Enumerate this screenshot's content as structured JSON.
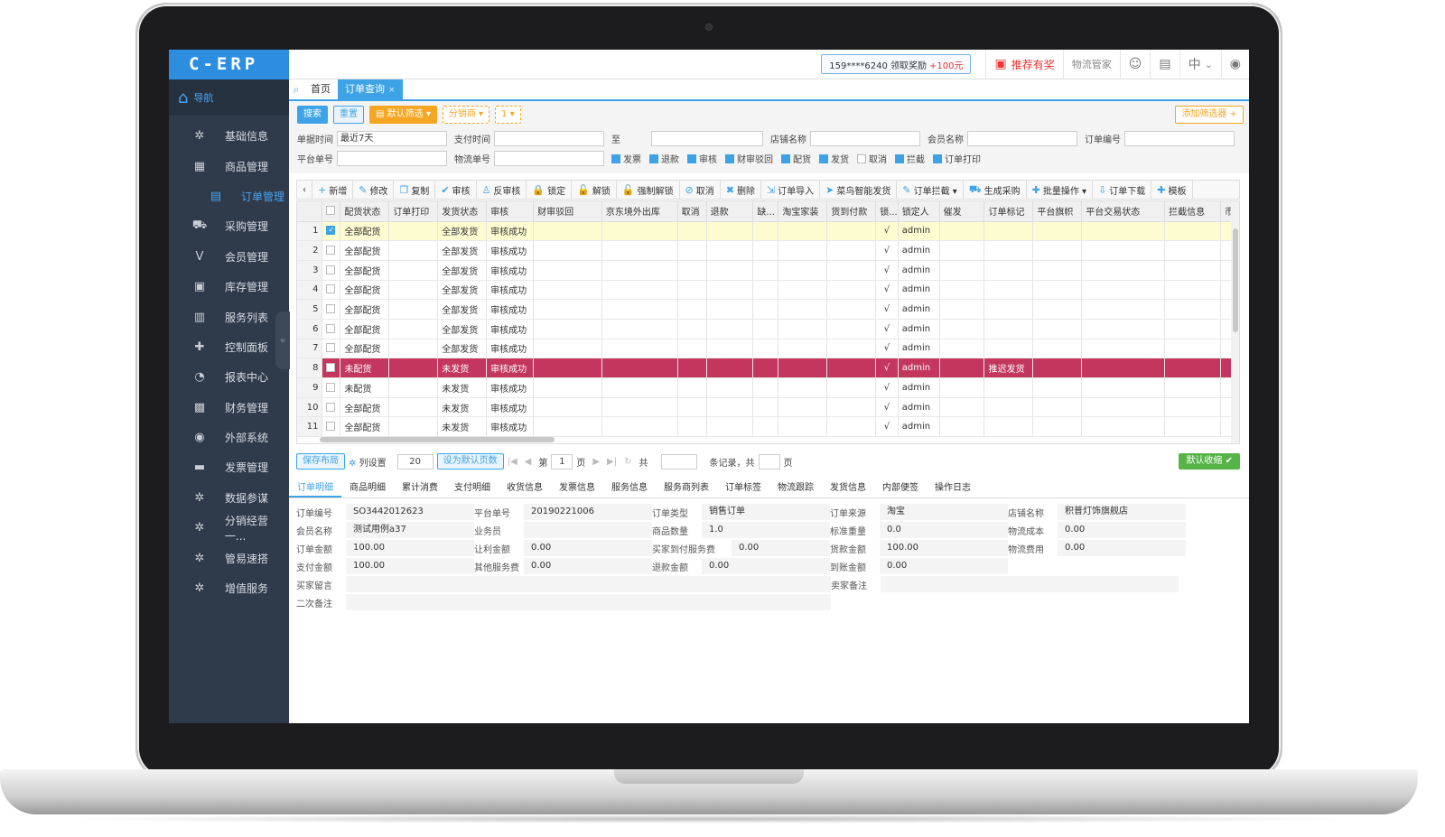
{
  "app": {
    "logo": "C-ERP",
    "nav_label": "导航"
  },
  "sidebar": {
    "items": [
      {
        "label": "基础信息",
        "icon": "gear-icon"
      },
      {
        "label": "商品管理",
        "icon": "store-icon"
      },
      {
        "label": "订单管理",
        "icon": "clipboard-icon",
        "sub": true
      },
      {
        "label": "采购管理",
        "icon": "cart-icon"
      },
      {
        "label": "会员管理",
        "icon": "v-icon"
      },
      {
        "label": "库存管理",
        "icon": "box-icon"
      },
      {
        "label": "服务列表",
        "icon": "book-icon"
      },
      {
        "label": "控制面板",
        "icon": "grid-icon"
      },
      {
        "label": "报表中心",
        "icon": "pie-icon"
      },
      {
        "label": "财务管理",
        "icon": "wallet-icon"
      },
      {
        "label": "外部系统",
        "icon": "compass-icon"
      },
      {
        "label": "发票管理",
        "icon": "invoice-icon"
      },
      {
        "label": "数据参谋",
        "icon": "gear-icon"
      },
      {
        "label": "分销经营一...",
        "icon": "gear-icon"
      },
      {
        "label": "管易速搭",
        "icon": "gear-icon"
      },
      {
        "label": "增值服务",
        "icon": "gear-icon"
      }
    ]
  },
  "topbar": {
    "promo": "159****6240 领取奖励",
    "promo_plus": "+100元",
    "recommend": "推荐有奖",
    "logistics": "物流管家",
    "lang": "中"
  },
  "tabs": {
    "home": "首页",
    "order_query": "订单查询",
    "close": "×"
  },
  "filters": {
    "search": "搜索",
    "reset": "重置",
    "default_filter": "默认筛选",
    "distributor": "分销商",
    "one": "1",
    "add_filter": "添加筛选器 +",
    "doc_time_label": "单据时间",
    "doc_time_value": "最近7天",
    "pay_time_label": "支付时间",
    "to": "至",
    "shop_name_label": "店铺名称",
    "member_name_label": "会员名称",
    "order_no_label": "订单编号",
    "platform_no_label": "平台单号",
    "logistics_no_label": "物流单号",
    "checks": [
      "发票",
      "退款",
      "审核",
      "财审驳回",
      "配货",
      "发货",
      "取消",
      "拦截",
      "订单打印"
    ]
  },
  "toolbar": [
    {
      "label": "新增",
      "icon": "plus-icon"
    },
    {
      "label": "修改",
      "icon": "edit-icon"
    },
    {
      "label": "复制",
      "icon": "copy-icon"
    },
    {
      "label": "审核",
      "icon": "check-icon"
    },
    {
      "label": "反审核",
      "icon": "user-icon"
    },
    {
      "label": "锁定",
      "icon": "lock-icon"
    },
    {
      "label": "解锁",
      "icon": "unlock-icon"
    },
    {
      "label": "强制解锁",
      "icon": "unlock-icon"
    },
    {
      "label": "取消",
      "icon": "cancel-icon"
    },
    {
      "label": "删除",
      "icon": "trash-icon"
    },
    {
      "label": "订单导入",
      "icon": "import-icon"
    },
    {
      "label": "菜鸟智能发货",
      "icon": "ship-icon"
    },
    {
      "label": "订单拦截 ▾",
      "icon": "edit-icon"
    },
    {
      "label": "生成采购",
      "icon": "cart-icon"
    },
    {
      "label": "批量操作 ▾",
      "icon": "grid-icon"
    },
    {
      "label": "订单下载",
      "icon": "download-icon"
    },
    {
      "label": "模板",
      "icon": "grid-icon"
    }
  ],
  "grid": {
    "columns": [
      "",
      "",
      "配货状态",
      "订单打印",
      "发货状态",
      "审核",
      "财审驳回",
      "京东境外出库",
      "取消",
      "退款",
      "缺...",
      "淘宝家装",
      "货到付款",
      "锁...",
      "锁定人",
      "催发",
      "订单标记",
      "平台旗帜",
      "平台交易状态",
      "拦截信息",
      "币"
    ],
    "rows": [
      {
        "n": "1",
        "alloc": "全部配货",
        "ship": "全部发货",
        "audit": "审核成功",
        "lock": "√",
        "locker": "admin",
        "mark": "",
        "checked": true
      },
      {
        "n": "2",
        "alloc": "全部配货",
        "ship": "全部发货",
        "audit": "审核成功",
        "lock": "√",
        "locker": "admin",
        "mark": ""
      },
      {
        "n": "3",
        "alloc": "全部配货",
        "ship": "全部发货",
        "audit": "审核成功",
        "lock": "√",
        "locker": "admin",
        "mark": ""
      },
      {
        "n": "4",
        "alloc": "全部配货",
        "ship": "全部发货",
        "audit": "审核成功",
        "lock": "√",
        "locker": "admin",
        "mark": ""
      },
      {
        "n": "5",
        "alloc": "全部配货",
        "ship": "全部发货",
        "audit": "审核成功",
        "lock": "√",
        "locker": "admin",
        "mark": ""
      },
      {
        "n": "6",
        "alloc": "全部配货",
        "ship": "全部发货",
        "audit": "审核成功",
        "lock": "√",
        "locker": "admin",
        "mark": ""
      },
      {
        "n": "7",
        "alloc": "全部配货",
        "ship": "全部发货",
        "audit": "审核成功",
        "lock": "√",
        "locker": "admin",
        "mark": ""
      },
      {
        "n": "8",
        "alloc": "未配货",
        "ship": "未发货",
        "audit": "审核成功",
        "lock": "√",
        "locker": "admin",
        "mark": "推迟发货"
      },
      {
        "n": "9",
        "alloc": "未配货",
        "ship": "未发货",
        "audit": "审核成功",
        "lock": "√",
        "locker": "admin",
        "mark": ""
      },
      {
        "n": "10",
        "alloc": "全部配货",
        "ship": "未发货",
        "audit": "审核成功",
        "lock": "√",
        "locker": "admin",
        "mark": ""
      },
      {
        "n": "11",
        "alloc": "全部配货",
        "ship": "未发货",
        "audit": "审核成功",
        "lock": "√",
        "locker": "admin",
        "mark": ""
      }
    ]
  },
  "pager": {
    "save_layout": "保存布局",
    "col_settings": "列设置",
    "page_size": "20",
    "set_default": "设为默认页数",
    "page_prefix": "第",
    "page_no": "1",
    "page_suffix": "页",
    "total_prefix": "共",
    "records": "条记录，共",
    "pages": "页",
    "collapse": "默认收缩"
  },
  "detail_tabs": [
    "订单明细",
    "商品明细",
    "累计消费",
    "支付明细",
    "收货信息",
    "发票信息",
    "服务信息",
    "服务商列表",
    "订单标签",
    "物流跟踪",
    "发货信息",
    "内部便签",
    "操作日志"
  ],
  "detail": {
    "order_no_l": "订单编号",
    "order_no": "SO3442012623",
    "plat_no_l": "平台单号",
    "plat_no": "20190221006",
    "order_type_l": "订单类型",
    "order_type": "销售订单",
    "source_l": "订单来源",
    "source": "淘宝",
    "shop_l": "店铺名称",
    "shop": "积普灯饰旗舰店",
    "member_l": "会员名称",
    "member": "测试用例a37",
    "sales_l": "业务员",
    "sales": "",
    "qty_l": "商品数量",
    "qty": "1.0",
    "std_weight_l": "标准重量",
    "std_weight": "0.0",
    "log_cost_l": "物流成本",
    "log_cost": "0.00",
    "amount_l": "订单金额",
    "amount": "100.00",
    "discount_l": "让利金额",
    "discount": "0.00",
    "buyer_fee_l": "买家到付服务费",
    "buyer_fee": "0.00",
    "goods_amt_l": "货款金额",
    "goods_amt": "100.00",
    "log_fee_l": "物流费用",
    "log_fee": "0.00",
    "paid_l": "支付金额",
    "paid": "100.00",
    "other_fee_l": "其他服务费",
    "other_fee": "0.00",
    "refund_l": "退款金额",
    "refund": "0.00",
    "arrive_l": "到账金额",
    "arrive": "0.00",
    "buyer_msg_l": "买家留言",
    "seller_note_l": "卖家备注",
    "second_note_l": "二次备注"
  }
}
